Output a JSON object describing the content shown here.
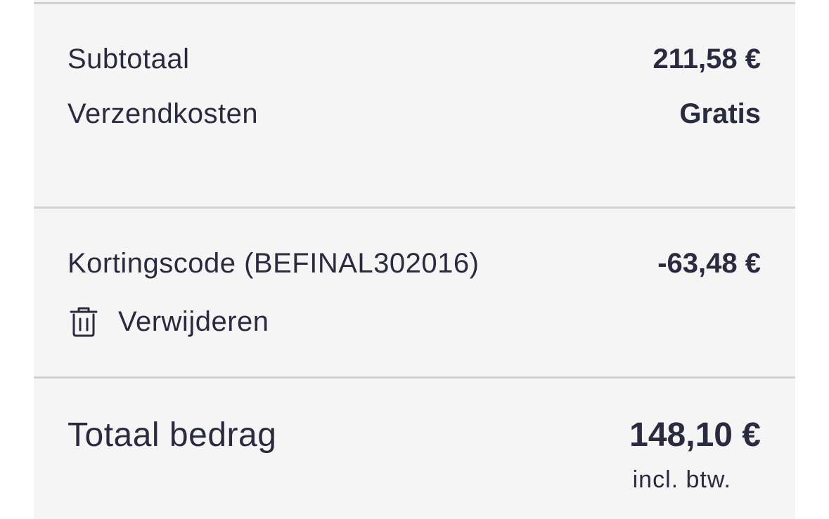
{
  "summary": {
    "subtotal": {
      "label": "Subtotaal",
      "value": "211,58 €"
    },
    "shipping": {
      "label": "Verzendkosten",
      "value": "Gratis"
    }
  },
  "discount": {
    "label": "Kortingscode (BEFINAL302016)",
    "value": "-63,48 €",
    "remove_label": "Verwijderen",
    "remove_icon": "trash-icon"
  },
  "total": {
    "label": "Totaal bedrag",
    "value": "148,10 €",
    "vat_note": "incl. btw."
  }
}
